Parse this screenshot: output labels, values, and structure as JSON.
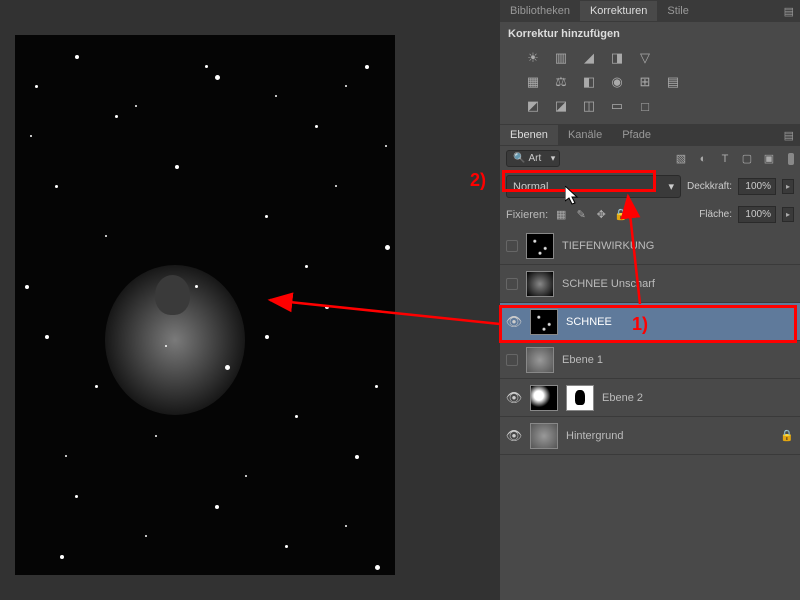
{
  "topTabs": {
    "bibliotheken": "Bibliotheken",
    "korrekturen": "Korrekturen",
    "stile": "Stile"
  },
  "korrTitle": "Korrektur hinzufügen",
  "layersTabs": {
    "ebenen": "Ebenen",
    "kanaele": "Kanäle",
    "pfade": "Pfade"
  },
  "kindFilter": "Art",
  "blend": {
    "mode": "Normal",
    "opacityLabel": "Deckkraft:",
    "opacityValue": "100%",
    "fillLabel": "Fläche:",
    "fillValue": "100%"
  },
  "lockLabel": "Fixieren:",
  "layers": [
    {
      "name": "TIEFENWIRKUNG",
      "visible": false,
      "selected": false,
      "locked": false,
      "thumb": "snow"
    },
    {
      "name": "SCHNEE Unscharf",
      "visible": false,
      "selected": false,
      "locked": false,
      "thumb": "blur"
    },
    {
      "name": "SCHNEE",
      "visible": true,
      "selected": true,
      "locked": false,
      "thumb": "snow"
    },
    {
      "name": "Ebene 1",
      "visible": false,
      "selected": false,
      "locked": false,
      "thumb": "fig"
    },
    {
      "name": "Ebene 2",
      "visible": true,
      "selected": false,
      "locked": false,
      "thumb": "dark",
      "mask": true
    },
    {
      "name": "Hintergrund",
      "visible": true,
      "selected": false,
      "locked": true,
      "thumb": "fig"
    }
  ],
  "annotations": {
    "label1": "1)",
    "label2": "2)"
  }
}
